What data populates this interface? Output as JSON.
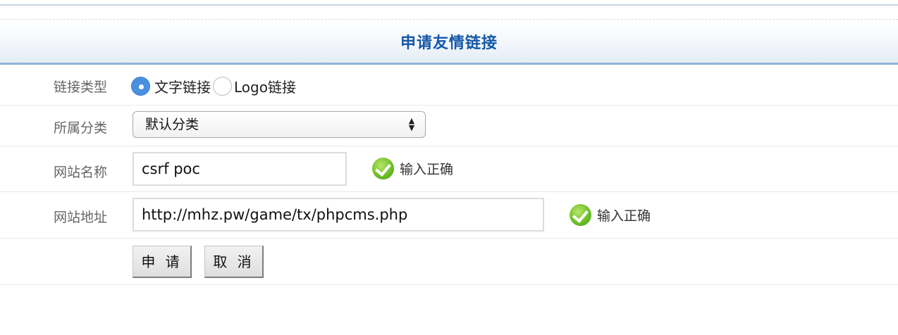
{
  "header": {
    "title": "申请友情链接"
  },
  "form": {
    "link_type": {
      "label": "链接类型",
      "options": [
        {
          "label": "文字链接",
          "selected": true
        },
        {
          "label": "Logo链接",
          "selected": false
        }
      ]
    },
    "category": {
      "label": "所属分类",
      "value": "默认分类"
    },
    "site_name": {
      "label": "网站名称",
      "value": "csrf poc",
      "status": "输入正确"
    },
    "site_url": {
      "label": "网站地址",
      "value": "http://mhz.pw/game/tx/phpcms.php",
      "status": "输入正确"
    },
    "buttons": {
      "submit": "申 请",
      "cancel": "取 消"
    }
  },
  "colors": {
    "accent": "#1458a8",
    "radio_selected": "#4a90e2",
    "check_green": "#6fbf2a"
  },
  "icons": {
    "valid": "check-circle-icon",
    "select": "up-down-arrows-icon"
  }
}
